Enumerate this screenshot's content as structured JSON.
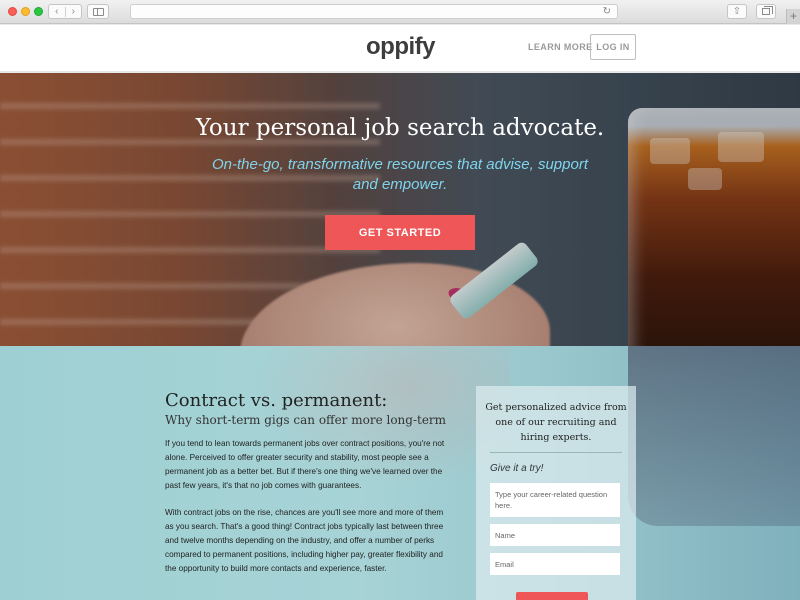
{
  "browser": {
    "address": "",
    "back_icon": "chevron-left-icon",
    "forward_icon": "chevron-right-icon",
    "new_tab_label": "+"
  },
  "header": {
    "logo": "oppify",
    "learn_more": "LEARN MORE",
    "login": "LOG IN"
  },
  "hero": {
    "title": "Your personal job search advocate.",
    "subtitle": "On-the-go, transformative resources that advise, support and empower.",
    "cta": "GET STARTED"
  },
  "article": {
    "title": "Contract vs. permanent:",
    "subtitle": "Why short-term gigs can offer more long-term",
    "paragraphs": [
      "If you tend to lean towards permanent jobs over contract positions, you're not alone. Perceived to offer greater security and stability, most people see a permanent job as a better bet. But if there's one thing we've learned over the past few years, it's that no job comes with guarantees.",
      "With contract jobs on the rise, chances are you'll see more and more of them as you search. That's a good thing! Contract jobs typically last between three and twelve months depending on the industry, and offer a number of perks compared to permanent positions, including higher pay, greater flexibility and the opportunity to build more contacts and experience, faster."
    ]
  },
  "form": {
    "heading": "Get personalized advice from one of our recruiting and hiring experts.",
    "tagline": "Give it a try!",
    "question_placeholder": "Type your career-related question here.",
    "name_placeholder": "Name",
    "email_placeholder": "Email"
  },
  "colors": {
    "accent": "#ee5658",
    "subtitle": "#7fd4ec",
    "band": "#a7d3d6"
  }
}
